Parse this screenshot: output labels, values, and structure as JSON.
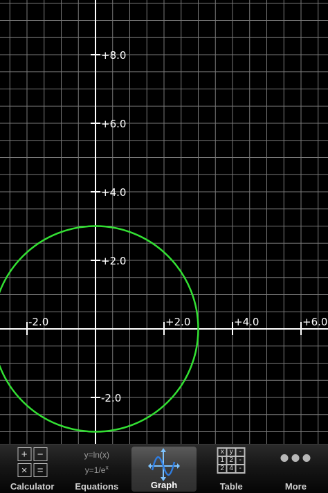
{
  "graph": {
    "x_tick_labels": [
      "-2.0",
      "+2.0",
      "+4.0",
      "+6.0"
    ],
    "y_tick_labels": [
      "+8.0",
      "+6.0",
      "+4.0",
      "+2.0",
      "-2.0"
    ],
    "x_ticks": [
      -2,
      2,
      4,
      6
    ],
    "y_ticks": [
      8,
      6,
      4,
      2,
      -2
    ],
    "curve": {
      "shape": "circle",
      "center": [
        0,
        0
      ],
      "radius": 3
    },
    "colors": {
      "grid": "#7a7a7a",
      "axes": "#ffffff",
      "curve": "#33e033",
      "background": "#000000"
    }
  },
  "tabbar": {
    "tabs": [
      {
        "id": "calculator",
        "label": "Calculator",
        "icon": "calculator-icon",
        "active": false,
        "cells": [
          "+",
          "−",
          "×",
          "="
        ]
      },
      {
        "id": "equations",
        "label": "Equations",
        "icon": "equations-icon",
        "active": false,
        "lines": [
          "y=ln(x)",
          "y=1/e",
          "x"
        ]
      },
      {
        "id": "graph",
        "label": "Graph",
        "icon": "graph-icon",
        "active": true
      },
      {
        "id": "table",
        "label": "Table",
        "icon": "table-icon",
        "active": false,
        "cells": [
          "x",
          "y",
          "-",
          "1",
          "2",
          "-",
          "2",
          "4",
          "-"
        ]
      },
      {
        "id": "more",
        "label": "More",
        "icon": "more-dots-icon",
        "active": false
      }
    ]
  }
}
